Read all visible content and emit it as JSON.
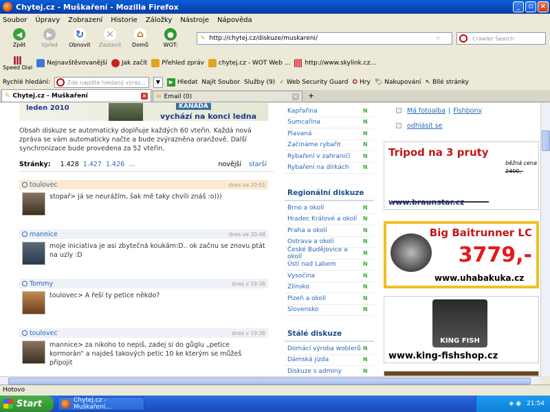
{
  "window": {
    "title": "Chytej.cz - Muškaření - Mozilla Firefox"
  },
  "menu": [
    "Soubor",
    "Úpravy",
    "Zobrazení",
    "Historie",
    "Záložky",
    "Nástroje",
    "Nápověda"
  ],
  "nav": {
    "back": "Zpět",
    "forward": "Vpřed",
    "reload": "Obnovit",
    "stop": "Zastavit",
    "home": "Domů",
    "wot": "WOT:",
    "url": "http://chytej.cz/diskuze/muskareni/",
    "search_placeholder": "Crawler Search"
  },
  "bookmarks": {
    "speed_dial": "Speed Dial",
    "items": [
      "Nejnavštěvovanější",
      "Jak začít",
      "Přehled zpráv",
      "chytej.cz - WOT Web ...",
      "http://www.skylink.cz..."
    ]
  },
  "quicksearch": {
    "label": "Rychlé hledání:",
    "placeholder": "Zde napište hledaný výraz...",
    "buttons": [
      "Hledat",
      "Najít Soubor",
      "Služby (9)",
      "Web Security Guard",
      "Hry",
      "Nakupování",
      "Bílé stránky"
    ]
  },
  "tabs": [
    "Chytej.cz - Muškaření",
    "Email (0)"
  ],
  "banner": {
    "line1": "leden 2010",
    "line2": "KANADA",
    "line3": "vychází na konci ledna"
  },
  "intro": "Obsah diskuze se automaticky doplňuje každých 60 vteřin. Každá nová zpráva se vám automaticky načte a bude zvýrazněna oranžově. Další synchronizace bude provedena za 52 vteřin.",
  "pager": {
    "label": "Stránky:",
    "pages": [
      "1.428",
      "1.427",
      "1.426",
      "..."
    ],
    "newer": "novější",
    "older": "starší"
  },
  "posts": [
    {
      "author": "toulovec",
      "time": "dnes ve 20:51",
      "text": "stopař> já se neurážím, šak mě taky chvíli znáš :o)))"
    },
    {
      "author": "mannice",
      "time": "dnes ve 20:48",
      "text": "moje iniciativa je asi zbytečná koukám:D.. ok začnu se znovu ptát na uzly :D"
    },
    {
      "author": "Tommy",
      "time": "dnes v 19:38",
      "text": "toulovec> A řeší ty petice někdo?"
    },
    {
      "author": "toulovec",
      "time": "dnes v 19:36",
      "text": "mannice> za nikoho to nepiš, zadej si do gůglu „petice kormorán“ a najdeš takových petic 10 ke kterým se můžeš připojit"
    }
  ],
  "topics": [
    "Kapřařina",
    "Sumcařina",
    "Plavaná",
    "Začínáme rybařit",
    "Rybaření v zahraničí",
    "Rybaření na dírkách"
  ],
  "regional": {
    "title": "Regionální diskuze",
    "items": [
      "Brno a okolí",
      "Hradec Králové a okolí",
      "Praha a okolí",
      "Ostrava a okolí",
      "České Budějovice a okolí",
      "Ústí nad Labem",
      "Vysočina",
      "Zlínsko",
      "Plzeň a okolí",
      "Slovensko"
    ]
  },
  "permanent": {
    "title": "Stálé diskuze",
    "items": [
      "Domácí výroba woblerů",
      "Dámská jízda",
      "Diskuze s adminy"
    ]
  },
  "new_badge": "N",
  "right_links": {
    "photo": "Má fotoalba",
    "sep": "|",
    "fishbony": "Fishbony",
    "logout": "odhlásit se"
  },
  "ads": {
    "tripod": {
      "title": "Tripod na 3 pruty",
      "price_label": "běžná cena",
      "price": "2400,-",
      "url": "www.braunstar.cz"
    },
    "reel": {
      "title": "Big Baitrunner LC",
      "price": "3779,-",
      "url": "www.uhabakuka.cz"
    },
    "kingfish": {
      "logo": "KING FISH",
      "url": "www.king-fishshop.cz"
    }
  },
  "statusbar": "Hotovo",
  "taskbar": {
    "start": "Start",
    "item": "Chytej.cz - Muškaření...",
    "clock": "21:54"
  },
  "colors": {
    "link": "#2a66b8",
    "accent_red": "#c01818",
    "new_green": "#3aaa3a",
    "post_header": "#fde9d2"
  }
}
